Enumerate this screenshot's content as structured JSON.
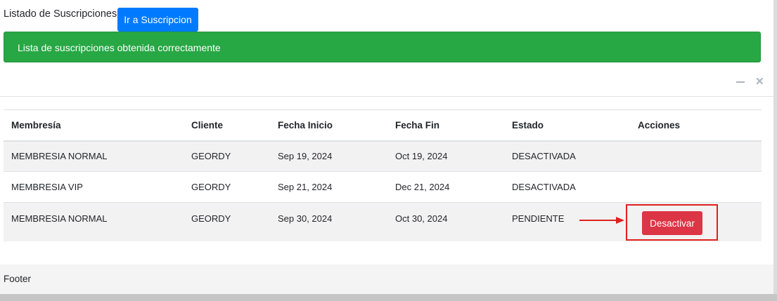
{
  "header": {
    "title": "Listado de Suscripciones",
    "goto_button": "Ir a Suscripcion"
  },
  "alert": {
    "message": "Lista de suscripciones obtenida correctamente"
  },
  "table": {
    "columns": [
      "Membresía",
      "Cliente",
      "Fecha Inicio",
      "Fecha Fin",
      "Estado",
      "Acciones"
    ],
    "rows": [
      {
        "membresia": "MEMBRESIA NORMAL",
        "cliente": "GEORDY",
        "fecha_inicio": "Sep 19, 2024",
        "fecha_fin": "Oct 19, 2024",
        "estado": "DESACTIVADA",
        "accion": ""
      },
      {
        "membresia": "MEMBRESIA VIP",
        "cliente": "GEORDY",
        "fecha_inicio": "Sep 21, 2024",
        "fecha_fin": "Dec 21, 2024",
        "estado": "DESACTIVADA",
        "accion": ""
      },
      {
        "membresia": "MEMBRESIA NORMAL",
        "cliente": "GEORDY",
        "fecha_inicio": "Sep 30, 2024",
        "fecha_fin": "Oct 30, 2024",
        "estado": "PENDIENTE",
        "accion": "Desactivar"
      }
    ]
  },
  "card_tools": {
    "minimize_icon": "minus-icon",
    "close_icon": "close-icon"
  },
  "footer": {
    "text": "Footer"
  },
  "colors": {
    "primary": "#007bff",
    "success": "#28a745",
    "danger": "#dc3545",
    "annotation": "#e02020"
  }
}
